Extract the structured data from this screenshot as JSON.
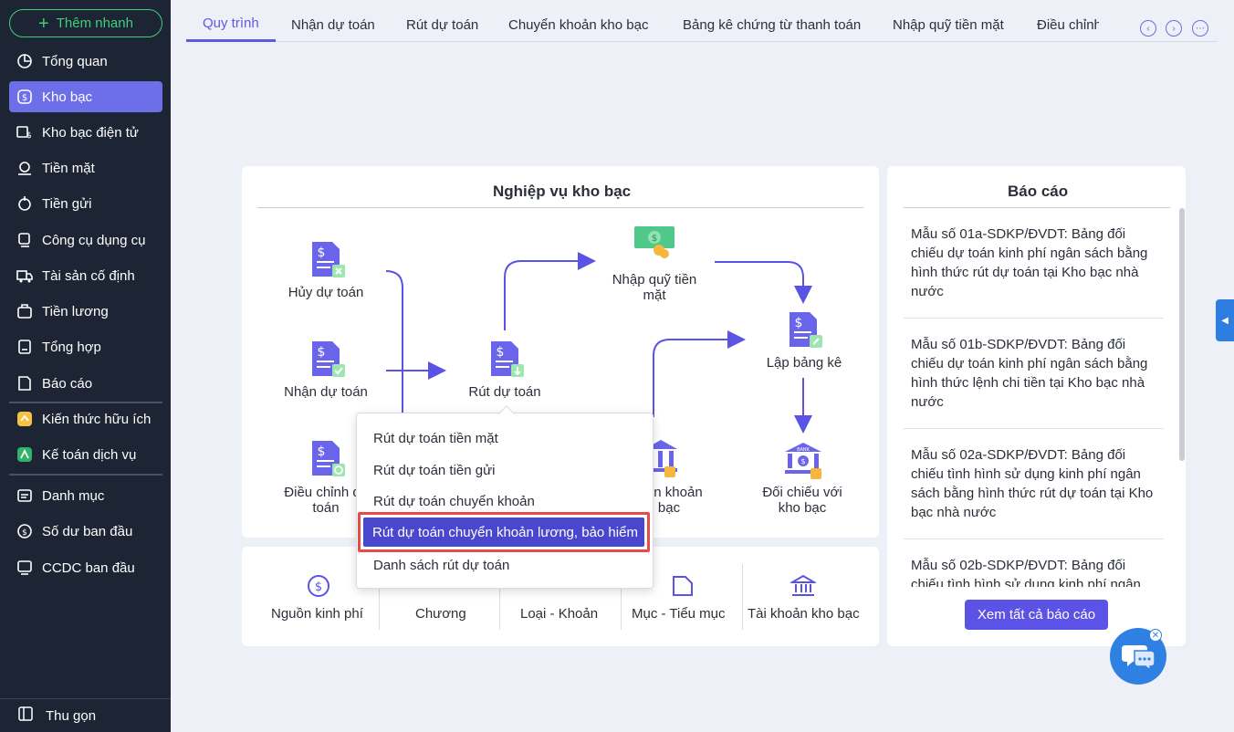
{
  "sidebar": {
    "quick_add": "Thêm nhanh",
    "items": [
      {
        "label": "Tổng quan",
        "icon": "dashboard-icon"
      },
      {
        "label": "Kho bạc",
        "icon": "treasury-icon",
        "active": true
      },
      {
        "label": "Kho bạc điện tử",
        "icon": "e-treasury-icon"
      },
      {
        "label": "Tiền mặt",
        "icon": "cash-icon"
      },
      {
        "label": "Tiền gửi",
        "icon": "deposit-icon"
      },
      {
        "label": "Công cụ dụng cụ",
        "icon": "tools-icon"
      },
      {
        "label": "Tài sản cố định",
        "icon": "truck-icon"
      },
      {
        "label": "Tiền lương",
        "icon": "salary-icon"
      },
      {
        "label": "Tổng hợp",
        "icon": "summary-icon"
      },
      {
        "label": "Báo cáo",
        "icon": "report-icon"
      },
      {
        "label": "Kiến thức hữu ích",
        "icon": "knowledge-icon"
      },
      {
        "label": "Kế toán dịch vụ",
        "icon": "service-icon"
      },
      {
        "label": "Danh mục",
        "icon": "catalog-icon"
      },
      {
        "label": "Số dư ban đầu",
        "icon": "balance-icon"
      },
      {
        "label": "CCDC ban đầu",
        "icon": "initial-tools-icon"
      }
    ],
    "collapse": "Thu gọn"
  },
  "tabs": [
    "Quy trình",
    "Nhận dự toán",
    "Rút dự toán",
    "Chuyển khoản kho bạc",
    "Bảng kê chứng từ thanh toán",
    "Nhập quỹ tiền mặt",
    "Điều chỉnh"
  ],
  "workflow": {
    "title": "Nghiệp vụ kho bạc",
    "nodes": {
      "huy": "Hủy dự toán",
      "nhan": "Nhận dự toán",
      "dieuchinh_1": "Điều chỉnh d",
      "dieuchinh_2": "toán",
      "rut": "Rút dự toán",
      "nhapquy_1": "Nhập quỹ tiền",
      "nhapquy_2": "mặt",
      "lapbangke": "Lập bảng kê",
      "chuyenkhoan_1": "n khoản",
      "chuyenkhoan_2": "bạc",
      "doichieu_1": "Đối chiếu với",
      "doichieu_2": "kho bạc"
    }
  },
  "menu": {
    "items": [
      "Rút dự toán tiền mặt",
      "Rút dự toán tiền gửi",
      "Rút dự toán chuyển khoản",
      "Rút dự toán chuyển khoản lương, bảo hiểm",
      "Danh sách rút dự toán"
    ]
  },
  "categories": [
    "Nguồn kinh phí",
    "Chương",
    "Loại - Khoản",
    "Mục - Tiểu mục",
    "Tài khoản kho bạc"
  ],
  "reports": {
    "title": "Báo cáo",
    "items": [
      [
        "Mẫu số 01a-SDKP/ĐVDT: Bảng đối",
        "chiếu dự toán kinh phí ngân sách bằng",
        "hình thức rút dự toán tại Kho bạc nhà",
        "nước"
      ],
      [
        "Mẫu số 01b-SDKP/ĐVDT: Bảng đối",
        "chiếu dự toán kinh phí ngân sách bằng",
        "hình thức lệnh chi tiền tại Kho bạc nhà",
        "nước"
      ],
      [
        "Mẫu số 02a-SDKP/ĐVDT: Bảng đối",
        "chiếu tình hình sử dụng kinh phí ngân",
        "sách bằng hình thức rút dự toán tại Kho",
        "bạc nhà nước"
      ],
      [
        "Mẫu số 02b-SDKP/ĐVDT: Bảng đối",
        "chiếu tình hình sử dụng kinh phí ngân"
      ]
    ],
    "view_all": "Xem tất cả báo cáo"
  }
}
